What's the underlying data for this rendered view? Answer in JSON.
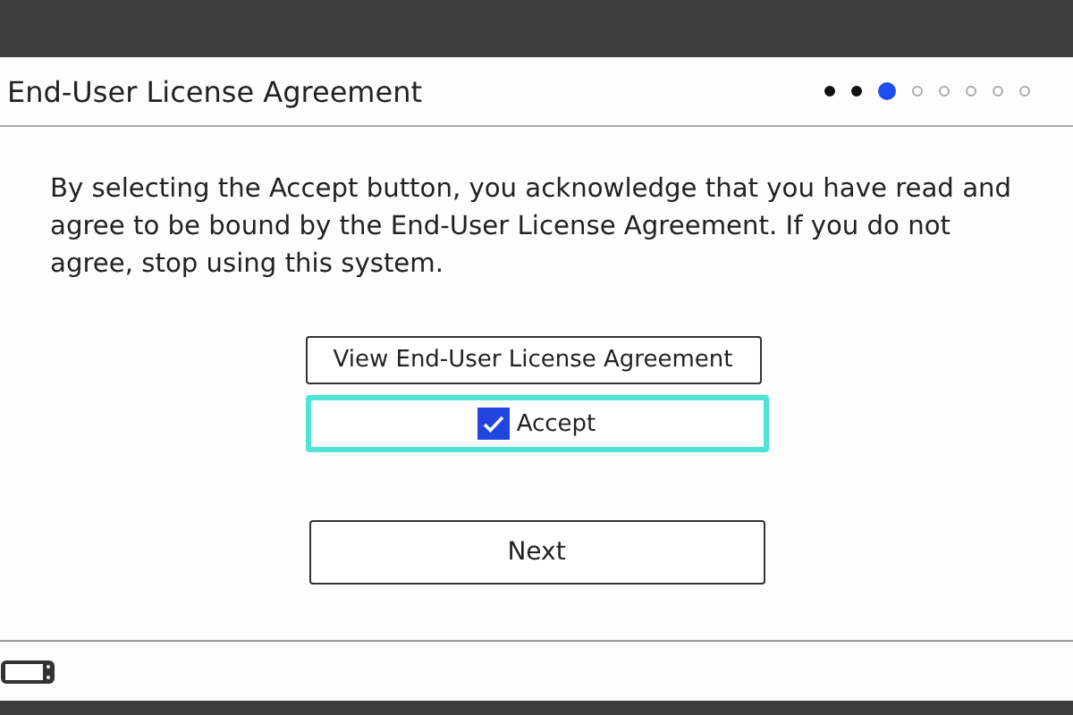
{
  "header": {
    "title": "End-User License Agreement",
    "steps": [
      {
        "completed": true,
        "selected": false
      },
      {
        "completed": true,
        "selected": false
      },
      {
        "completed": false,
        "selected": true
      },
      {
        "completed": false,
        "selected": false
      },
      {
        "completed": false,
        "selected": false
      },
      {
        "completed": false,
        "selected": false
      },
      {
        "completed": false,
        "selected": false
      },
      {
        "completed": false,
        "selected": false
      }
    ]
  },
  "message": "By selecting the Accept button, you acknowledge that you have read and agree to be bound by the End-User License Agreement. If you do not agree, stop using this system.",
  "controls": [
    {
      "kind": "button",
      "label": "View End-User License Agreement",
      "focused": false
    },
    {
      "kind": "checkbox",
      "label": "Accept",
      "checked": true,
      "focused": true
    }
  ],
  "next_button": {
    "label": "Next",
    "focused": false
  }
}
